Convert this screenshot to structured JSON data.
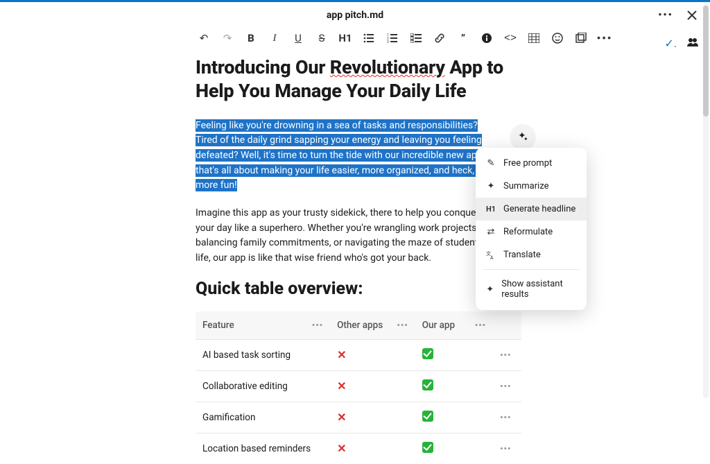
{
  "window": {
    "title": "app pitch.md"
  },
  "toolbar": {
    "items": [
      "undo",
      "redo",
      "bold",
      "italic",
      "underline",
      "strike",
      "heading",
      "bullets",
      "numbered",
      "tasks",
      "link",
      "quote",
      "info",
      "code",
      "table",
      "emoji",
      "embed",
      "more"
    ]
  },
  "doc": {
    "title_line1": "Introducing Our ",
    "title_word_err": "Revolutionary",
    "title_line1b": " App to",
    "title_line2": "Help You Manage Your Daily Life",
    "para1": "Feeling like you're drowning in a sea of tasks and responsibilities? Tired of the daily grind sapping your energy and leaving you feeling defeated? Well, it's time to turn the tide with our incredible new app that's all about making your life easier, more organized, and heck, even more fun!",
    "para2": "Imagine this app as your trusty sidekick, there to help you conquer your day like a superhero. Whether you're wrangling work projects, balancing family commitments, or navigating the maze of student life, our app is like that wise friend who's got your back.",
    "subhead": "Quick table overview:"
  },
  "table": {
    "headers": [
      "Feature",
      "Other apps",
      "Our app",
      ""
    ],
    "rows": [
      {
        "feature": "AI based task sorting",
        "other": false,
        "ours": true
      },
      {
        "feature": "Collaborative editing",
        "other": false,
        "ours": true
      },
      {
        "feature": "Gamification",
        "other": false,
        "ours": true
      },
      {
        "feature": "Location based reminders",
        "other": false,
        "ours": true
      }
    ]
  },
  "ai_menu": {
    "items": [
      {
        "icon": "pencil",
        "label": "Free prompt"
      },
      {
        "icon": "sparkle",
        "label": "Summarize"
      },
      {
        "icon": "h1",
        "label": "Generate headline",
        "active": true
      },
      {
        "icon": "shuffle",
        "label": "Reformulate"
      },
      {
        "icon": "translate",
        "label": "Translate"
      }
    ],
    "footer": {
      "icon": "sparkle",
      "label": "Show assistant results"
    }
  }
}
